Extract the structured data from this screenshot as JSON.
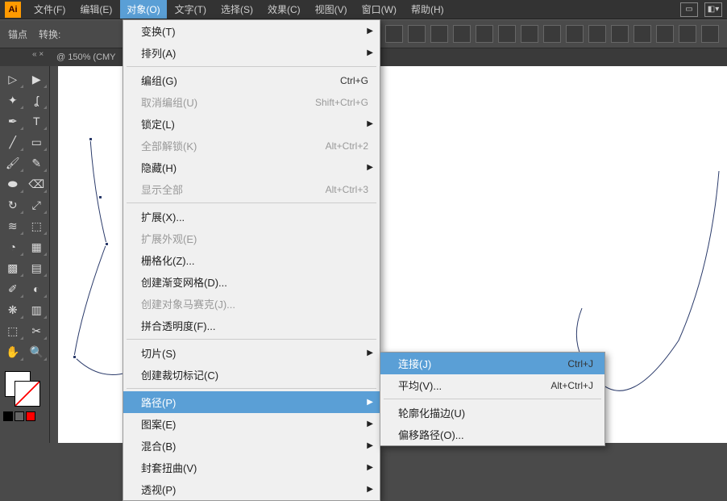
{
  "logo": "Ai",
  "menubar": {
    "file": "文件(F)",
    "edit": "编辑(E)",
    "object": "对象(O)",
    "type": "文字(T)",
    "select": "选择(S)",
    "effect": "效果(C)",
    "view": "视图(V)",
    "window": "窗口(W)",
    "help": "帮助(H)"
  },
  "controlbar": {
    "anchor": "锚点",
    "convert": "转换:"
  },
  "tabbar": {
    "zoom": "@ 150% (CMY"
  },
  "dropdown": {
    "transform": "变换(T)",
    "arrange": "排列(A)",
    "group": "编组(G)",
    "group_sc": "Ctrl+G",
    "ungroup": "取消编组(U)",
    "ungroup_sc": "Shift+Ctrl+G",
    "lock": "锁定(L)",
    "unlock_all": "全部解锁(K)",
    "unlock_all_sc": "Alt+Ctrl+2",
    "hide": "隐藏(H)",
    "show_all": "显示全部",
    "show_all_sc": "Alt+Ctrl+3",
    "expand": "扩展(X)...",
    "expand_appearance": "扩展外观(E)",
    "rasterize": "栅格化(Z)...",
    "gradient_mesh": "创建渐变网格(D)...",
    "mosaic": "创建对象马赛克(J)...",
    "flatten": "拼合透明度(F)...",
    "slice": "切片(S)",
    "crop_marks": "创建裁切标记(C)",
    "path": "路径(P)",
    "pattern": "图案(E)",
    "blend": "混合(B)",
    "envelope": "封套扭曲(V)",
    "perspective": "透视(P)"
  },
  "submenu": {
    "join": "连接(J)",
    "join_sc": "Ctrl+J",
    "average": "平均(V)...",
    "average_sc": "Alt+Ctrl+J",
    "outline_stroke": "轮廓化描边(U)",
    "offset_path": "偏移路径(O)..."
  }
}
